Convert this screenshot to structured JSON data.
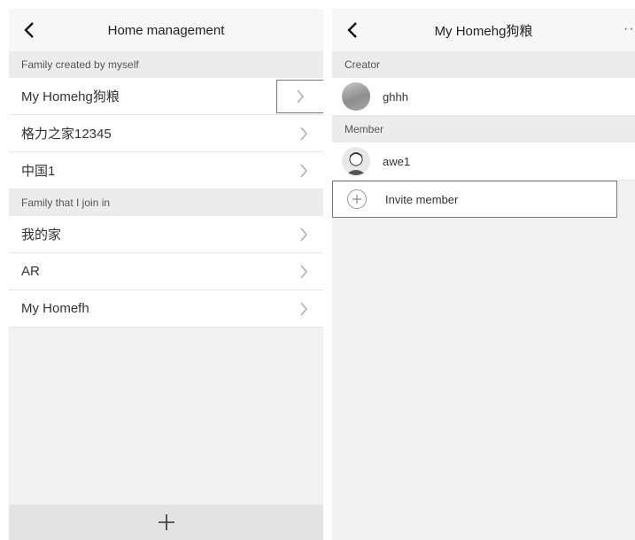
{
  "left": {
    "title": "Home management",
    "back_icon": "chevron-left-icon",
    "created_section_label": "Family created by myself",
    "created_families": [
      {
        "name": "My Homehg狗粮"
      },
      {
        "name": "格力之家12345"
      },
      {
        "name": "中国1"
      }
    ],
    "joined_section_label": "Family that I join in",
    "joined_families": [
      {
        "name": "我的家"
      },
      {
        "name": "AR"
      },
      {
        "name": "My Homefh"
      }
    ],
    "add_icon": "plus-icon"
  },
  "right": {
    "title": "My Homehg狗粮",
    "back_icon": "chevron-left-icon",
    "more_label": "···",
    "creator_section_label": "Creator",
    "creator": {
      "name": "ghhh"
    },
    "member_section_label": "Member",
    "members": [
      {
        "name": "awe1"
      }
    ],
    "invite_label": "Invite member"
  },
  "colors": {
    "panel_bg": "#f2f2f2",
    "row_bg": "#ffffff",
    "section_bg": "#ececec",
    "bottom_bar_bg": "#e3e3e3"
  }
}
